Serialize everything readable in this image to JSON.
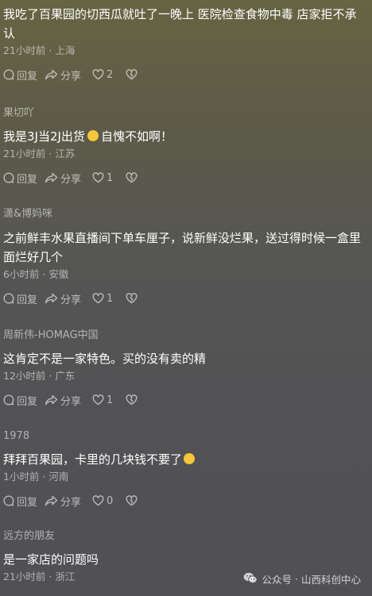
{
  "comments": [
    {
      "author": "",
      "text": "我吃了百果园的切西瓜就吐了一晚上 医院检查食物中毒 店家拒不承认",
      "time": "21小时前",
      "location": "上海",
      "likes": "2"
    },
    {
      "author": "果切吖",
      "text_before": "我是3J当2J出货",
      "emoji": "laughing-crying-emoji",
      "text_after": "自愧不如啊！",
      "time": "21小时前",
      "location": "江苏",
      "likes": "1"
    },
    {
      "author": "潇&博妈咪",
      "text": "之前鲜丰水果直播间下单车厘子，说新鲜没烂果，送过得时候一盒里面烂好几个",
      "time": "6小时前",
      "location": "安徽",
      "likes": "1"
    },
    {
      "author": "周新伟-HOMAG中国",
      "text": "这肯定不是一家特色。买的没有卖的精",
      "time": "12小时前",
      "location": "广东",
      "likes": "1"
    },
    {
      "author": "1978",
      "text_before": "拜拜百果园，卡里的几块钱不要了",
      "emoji": "thinking-emoji",
      "text_after": "",
      "time": "1小时前",
      "location": "河南",
      "likes": "0"
    },
    {
      "author": "远方的朋友",
      "text": "是一家店的问题吗",
      "time": "21小时前",
      "location": "浙江"
    }
  ],
  "labels": {
    "reply": "回复",
    "share": "分享",
    "separator": "·"
  },
  "watermark": {
    "prefix": "公众号",
    "separator": "·",
    "name": "山西科创中心"
  },
  "colors": {
    "text": "#ffffff",
    "muted": "rgba(255,255,255,0.55)",
    "background_top": "#676443",
    "background_bottom": "#505055",
    "emoji": "#f5c53a"
  }
}
